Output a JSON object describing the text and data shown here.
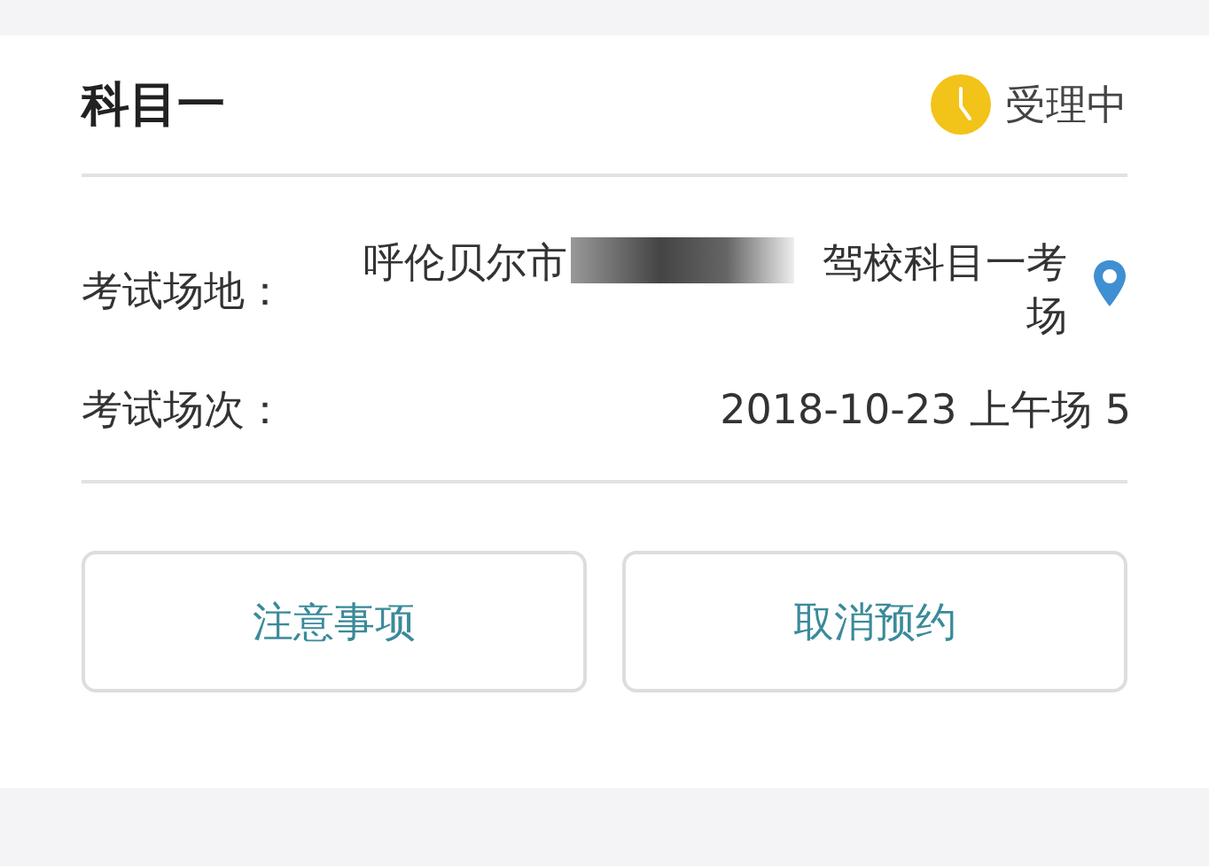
{
  "card": {
    "title": "科目一",
    "status": "受理中"
  },
  "fields": [
    {
      "kind": "location",
      "label": "考试场地：",
      "value_before": "呼伦贝尔市",
      "value_after": "驾校科目一考场"
    },
    {
      "kind": "text",
      "label": "考试场次：",
      "value": "2018-10-23 上午场 5"
    }
  ],
  "buttons": [
    "注意事项",
    "取消预约"
  ]
}
